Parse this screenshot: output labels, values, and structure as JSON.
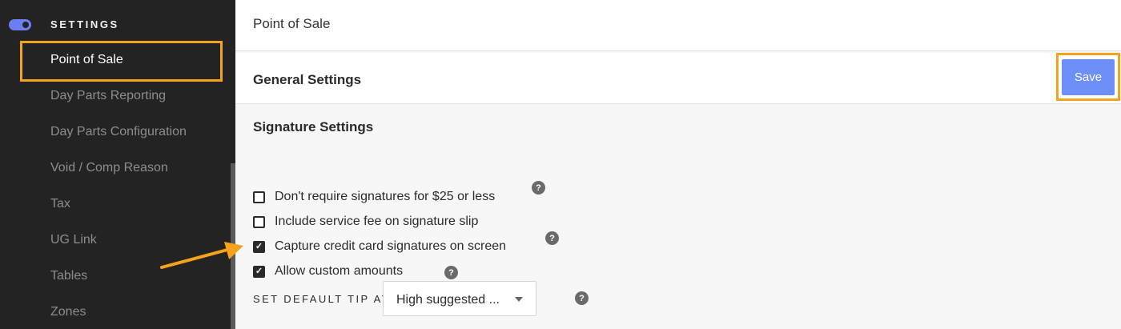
{
  "sidebar": {
    "section_title": "SETTINGS",
    "items": [
      {
        "label": "Point of Sale",
        "active": true
      },
      {
        "label": "Day Parts Reporting"
      },
      {
        "label": "Day Parts Configuration"
      },
      {
        "label": "Void / Comp Reason"
      },
      {
        "label": "Tax"
      },
      {
        "label": "UG Link"
      },
      {
        "label": "Tables"
      },
      {
        "label": "Zones"
      }
    ]
  },
  "header": {
    "title": "Point of Sale"
  },
  "general": {
    "title": "General Settings",
    "save_label": "Save"
  },
  "signature": {
    "title": "Signature Settings",
    "options": [
      {
        "label": "Don't require signatures for $25 or less",
        "checked": false
      },
      {
        "label": "Include service fee on signature slip",
        "checked": false
      },
      {
        "label": "Capture credit card signatures on screen",
        "checked": true
      },
      {
        "label": "Allow custom amounts",
        "checked": true
      }
    ],
    "tip_label": "SET DEFAULT TIP AT",
    "tip_value": "High suggested ..."
  },
  "help_glyph": "?",
  "check_glyph": "✓",
  "colors": {
    "accent": "#6d8ff7",
    "highlight": "#f7a21b",
    "sidebar_bg": "#232323"
  }
}
